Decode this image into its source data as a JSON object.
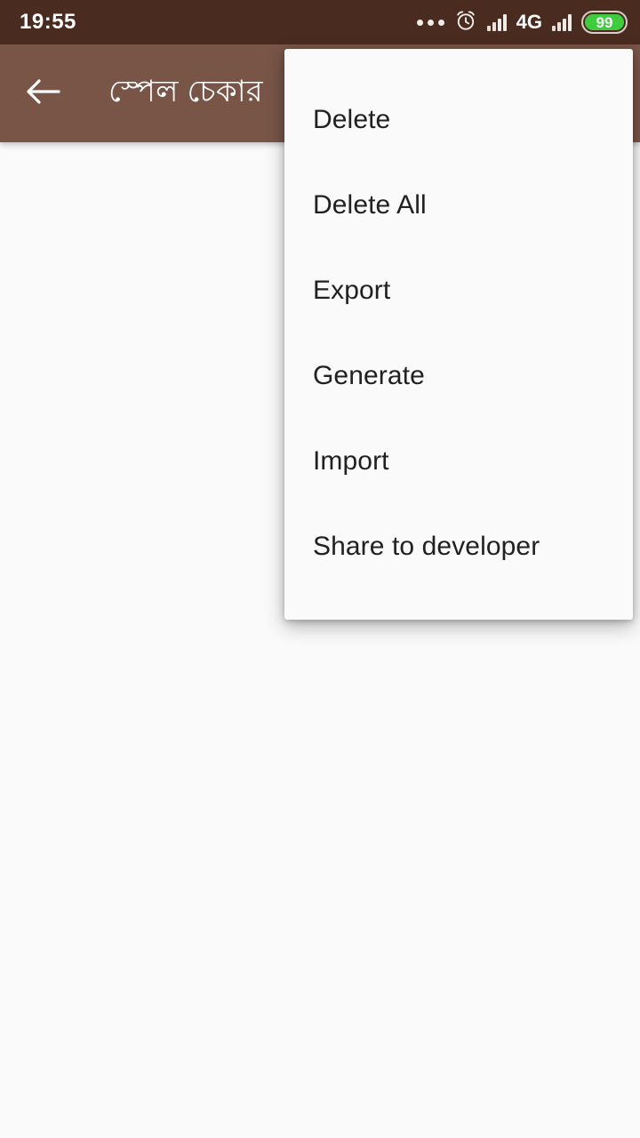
{
  "status_bar": {
    "time": "19:55",
    "network_label": "4G",
    "battery_level": "99",
    "icons": {
      "more_dots": "more-dots-icon",
      "alarm": "alarm-clock-icon",
      "signal_1": "signal-bars-icon",
      "signal_2": "signal-bars-icon",
      "battery": "battery-icon"
    },
    "colors": {
      "background": "#4a2b20",
      "battery_fill": "#3fcc3f",
      "foreground": "#ffffff"
    }
  },
  "toolbar": {
    "title": "স্পেল চেকার",
    "back_icon": "back-arrow-icon",
    "colors": {
      "background": "#795548",
      "foreground": "#ffffff"
    }
  },
  "overflow_menu": {
    "items": [
      {
        "label": "Delete"
      },
      {
        "label": "Delete All"
      },
      {
        "label": "Export"
      },
      {
        "label": "Generate"
      },
      {
        "label": "Import"
      },
      {
        "label": "Share to developer"
      }
    ],
    "colors": {
      "background": "#fafafa",
      "text": "#212121"
    }
  },
  "content": {
    "background": "#fafafa"
  }
}
